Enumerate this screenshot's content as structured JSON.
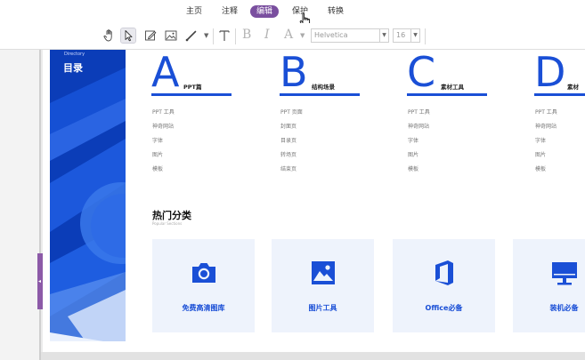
{
  "menu": {
    "items": [
      {
        "label": "主页",
        "active": false
      },
      {
        "label": "注释",
        "active": false
      },
      {
        "label": "编辑",
        "active": true
      },
      {
        "label": "保护",
        "active": false
      },
      {
        "label": "转换",
        "active": false
      }
    ]
  },
  "toolbar": {
    "tools": [
      "hand-tool-icon",
      "select-arrow-icon",
      "edit-text-box-icon",
      "edit-image-icon",
      "line-tool-icon",
      "text-tool-icon"
    ],
    "bold": "B",
    "italic": "I",
    "font_color": "A",
    "font_family": "Helvetica",
    "font_size": "16"
  },
  "sidebar_tab": "◂",
  "page": {
    "directory_sub": "Directory",
    "directory_title": "目录",
    "sections": [
      {
        "letter": "A",
        "label": "PPT篇",
        "items": [
          "PPT 工具",
          "神奇网站",
          "字体",
          "图片",
          "模板"
        ]
      },
      {
        "letter": "B",
        "label": "结构场景",
        "items": [
          "PPT 页面",
          "封面页",
          "目录页",
          "转场页",
          "结束页"
        ]
      },
      {
        "letter": "C",
        "label": "素材工具",
        "items": [
          "PPT 工具",
          "神奇网站",
          "字体",
          "图片",
          "模板"
        ]
      },
      {
        "letter": "D",
        "label": "素材",
        "items": [
          "PPT 工具",
          "神奇网站",
          "字体",
          "图片",
          "模板"
        ]
      }
    ],
    "hot_title": "热门分类",
    "hot_sub": "Popular Sections",
    "cards": [
      {
        "label": "免费高清图库",
        "icon": "camera-icon"
      },
      {
        "label": "图片工具",
        "icon": "picture-icon"
      },
      {
        "label": "Office必备",
        "icon": "office-icon"
      },
      {
        "label": "装机必备",
        "icon": "monitor-icon"
      }
    ]
  },
  "colors": {
    "accent_purple": "#7a4f9f",
    "brand_blue": "#1a4fd6",
    "panel_blue": "#0b3db8",
    "card_bg": "#eef3fc"
  }
}
